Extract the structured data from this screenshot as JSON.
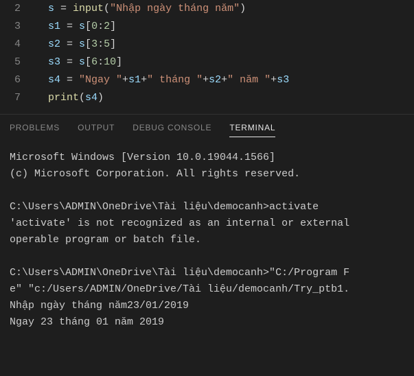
{
  "editor": {
    "lines": [
      {
        "n": "2",
        "tokens": [
          {
            "c": "tk-var",
            "t": "s"
          },
          {
            "c": "tk-op",
            "t": " = "
          },
          {
            "c": "tk-fn",
            "t": "input"
          },
          {
            "c": "tk-par",
            "t": "("
          },
          {
            "c": "tk-str",
            "t": "\"Nhập ngày tháng năm\""
          },
          {
            "c": "tk-par",
            "t": ")"
          }
        ]
      },
      {
        "n": "3",
        "tokens": [
          {
            "c": "tk-var",
            "t": "s1"
          },
          {
            "c": "tk-op",
            "t": " = "
          },
          {
            "c": "tk-var",
            "t": "s"
          },
          {
            "c": "tk-par",
            "t": "["
          },
          {
            "c": "tk-num",
            "t": "0"
          },
          {
            "c": "tk-op",
            "t": ":"
          },
          {
            "c": "tk-num",
            "t": "2"
          },
          {
            "c": "tk-par",
            "t": "]"
          }
        ]
      },
      {
        "n": "4",
        "tokens": [
          {
            "c": "tk-var",
            "t": "s2"
          },
          {
            "c": "tk-op",
            "t": " = "
          },
          {
            "c": "tk-var",
            "t": "s"
          },
          {
            "c": "tk-par",
            "t": "["
          },
          {
            "c": "tk-num",
            "t": "3"
          },
          {
            "c": "tk-op",
            "t": ":"
          },
          {
            "c": "tk-num",
            "t": "5"
          },
          {
            "c": "tk-par",
            "t": "]"
          }
        ]
      },
      {
        "n": "5",
        "tokens": [
          {
            "c": "tk-var",
            "t": "s3"
          },
          {
            "c": "tk-op",
            "t": " = "
          },
          {
            "c": "tk-var",
            "t": "s"
          },
          {
            "c": "tk-par",
            "t": "["
          },
          {
            "c": "tk-num",
            "t": "6"
          },
          {
            "c": "tk-op",
            "t": ":"
          },
          {
            "c": "tk-num",
            "t": "10"
          },
          {
            "c": "tk-par",
            "t": "]"
          }
        ]
      },
      {
        "n": "6",
        "tokens": [
          {
            "c": "tk-var",
            "t": "s4"
          },
          {
            "c": "tk-op",
            "t": " = "
          },
          {
            "c": "tk-str",
            "t": "\"Ngay \""
          },
          {
            "c": "tk-op",
            "t": "+"
          },
          {
            "c": "tk-var",
            "t": "s1"
          },
          {
            "c": "tk-op",
            "t": "+"
          },
          {
            "c": "tk-str",
            "t": "\" tháng \""
          },
          {
            "c": "tk-op",
            "t": "+"
          },
          {
            "c": "tk-var",
            "t": "s2"
          },
          {
            "c": "tk-op",
            "t": "+"
          },
          {
            "c": "tk-str",
            "t": "\" năm \""
          },
          {
            "c": "tk-op",
            "t": "+"
          },
          {
            "c": "tk-var",
            "t": "s3"
          }
        ]
      },
      {
        "n": "7",
        "tokens": [
          {
            "c": "tk-fn",
            "t": "print"
          },
          {
            "c": "tk-par",
            "t": "("
          },
          {
            "c": "tk-var",
            "t": "s4"
          },
          {
            "c": "tk-par",
            "t": ")"
          }
        ]
      }
    ]
  },
  "panel": {
    "tabs": {
      "problems": "PROBLEMS",
      "output": "OUTPUT",
      "debug": "DEBUG CONSOLE",
      "terminal": "TERMINAL"
    },
    "terminal_lines": [
      "Microsoft Windows [Version 10.0.19044.1566]",
      "(c) Microsoft Corporation. All rights reserved.",
      "",
      "C:\\Users\\ADMIN\\OneDrive\\Tài liệu\\democanh>activate",
      "'activate' is not recognized as an internal or external",
      "operable program or batch file.",
      "",
      "C:\\Users\\ADMIN\\OneDrive\\Tài liệu\\democanh>\"C:/Program F",
      "e\" \"c:/Users/ADMIN/OneDrive/Tài liệu/democanh/Try_ptb1.",
      "Nhập ngày tháng năm23/01/2019",
      "Ngay 23 tháng 01 năm 2019"
    ]
  }
}
